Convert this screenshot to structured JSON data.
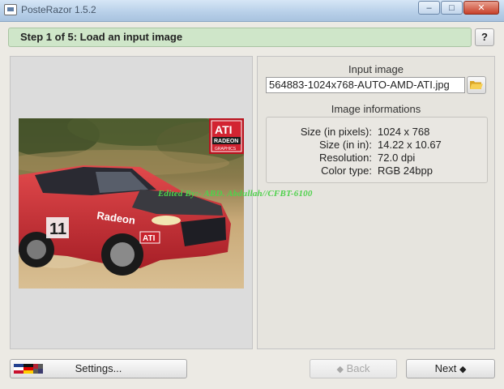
{
  "window": {
    "title": "PosteRazor 1.5.2",
    "minimize": "–",
    "maximize": "□",
    "close": "✕"
  },
  "step": {
    "title": "Step 1 of 5: Load an input image",
    "help_label": "?"
  },
  "input_image": {
    "heading": "Input image",
    "filename": "564883-1024x768-AUTO-AMD-ATI.jpg"
  },
  "image_info": {
    "heading": "Image informations",
    "rows": [
      {
        "label": "Size (in pixels):",
        "value": "1024 x 768"
      },
      {
        "label": "Size (in in):",
        "value": "14.22 x 10.67"
      },
      {
        "label": "Resolution:",
        "value": "72.0 dpi"
      },
      {
        "label": "Color type:",
        "value": "RGB 24bpp"
      }
    ]
  },
  "photo": {
    "badge_top": "ATI",
    "badge_mid": "RADEON",
    "badge_bottom": "GRAPHICS",
    "door_number": "11",
    "car_text": "Radeon",
    "hood_badge": "ATI",
    "colors": {
      "car_red": "#d8343a",
      "dirt": "#c9a979",
      "foliage": "#4c5a2e"
    }
  },
  "watermark": "Edited By:- ABD. Abdullah//CFBT-6100",
  "buttons": {
    "settings_label": "Settings...",
    "back_label": "Back",
    "back_arrow": "◆",
    "next_label": "Next",
    "next_arrow": "◆"
  }
}
